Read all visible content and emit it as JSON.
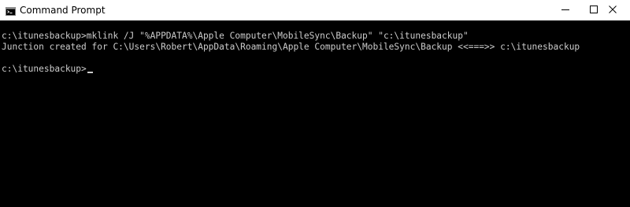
{
  "window": {
    "title": "Command Prompt",
    "icon": "cmd-icon",
    "controls": [
      "minimize-icon",
      "maximize-icon",
      "close-icon"
    ]
  },
  "console": {
    "lines": [
      "c:\\itunesbackup>mklink /J \"%APPDATA%\\Apple Computer\\MobileSync\\Backup\" \"c:\\itunesbackup\"",
      "Junction created for C:\\Users\\Robert\\AppData\\Roaming\\Apple Computer\\MobileSync\\Backup <<===>> c:\\itunesbackup",
      "",
      "c:\\itunesbackup>"
    ]
  },
  "colors": {
    "titlebar_bg": "#ffffff",
    "console_bg": "#000000",
    "console_text": "#cccccc"
  }
}
